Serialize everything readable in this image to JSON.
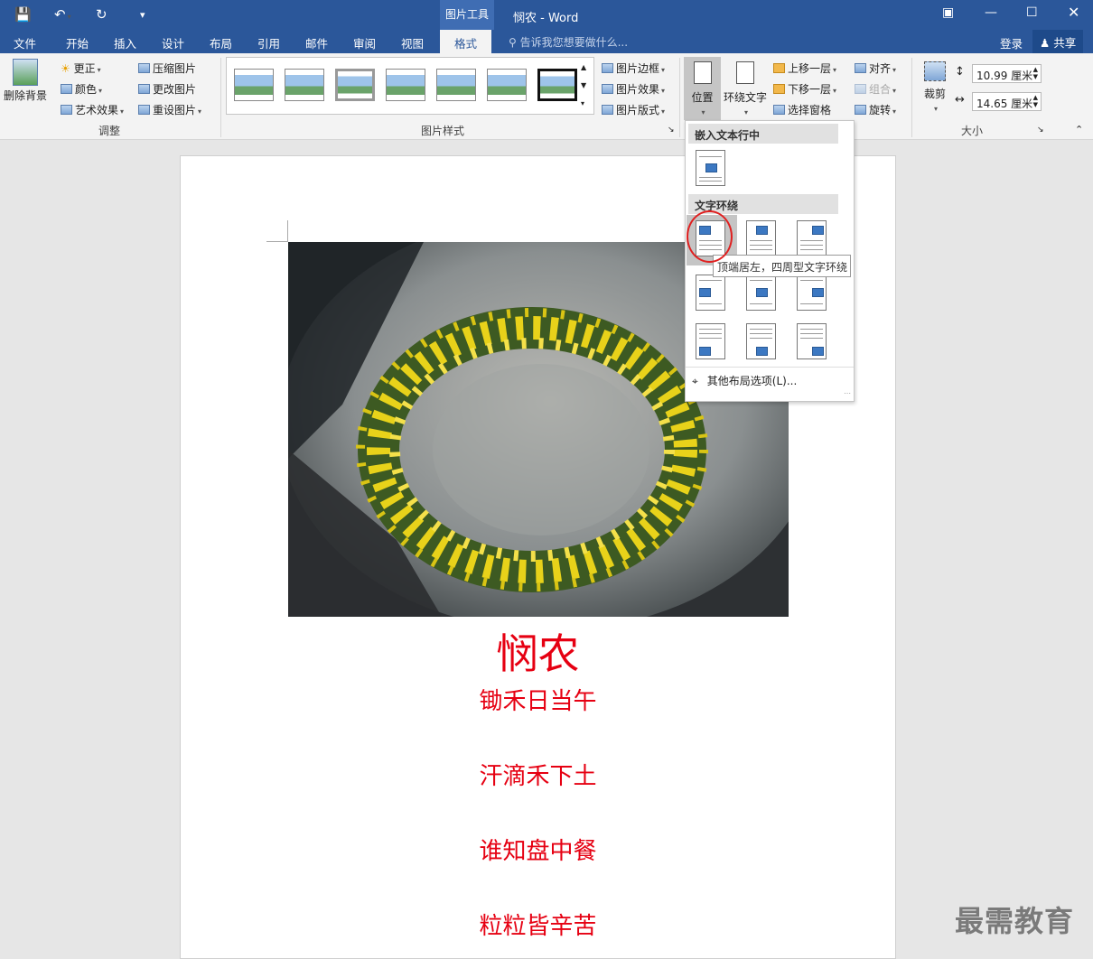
{
  "titlebar": {
    "context_group": "图片工具",
    "doc_title": "悯农 - Word"
  },
  "tabs": {
    "file": "文件",
    "home": "开始",
    "insert": "插入",
    "design": "设计",
    "layout": "布局",
    "references": "引用",
    "mailings": "邮件",
    "review": "审阅",
    "view": "视图",
    "format": "格式",
    "tell_me": "告诉我您想要做什么...",
    "signin": "登录",
    "share": "共享"
  },
  "ribbon": {
    "adjust": {
      "remove_bg": "删除背景",
      "corrections": "更正",
      "color": "颜色",
      "artistic": "艺术效果",
      "compress": "压缩图片",
      "change": "更改图片",
      "reset": "重设图片",
      "group_label": "调整"
    },
    "styles": {
      "border": "图片边框",
      "effects": "图片效果",
      "layout": "图片版式",
      "group_label": "图片样式"
    },
    "arrange": {
      "position": "位置",
      "wrap_text": "环绕文字",
      "bring_forward": "上移一层",
      "send_backward": "下移一层",
      "selection_pane": "选择窗格",
      "align": "对齐",
      "group": "组合",
      "rotate": "旋转"
    },
    "size": {
      "crop": "裁剪",
      "height": "10.99 厘米",
      "width": "14.65 厘米",
      "group_label": "大小"
    }
  },
  "dropdown": {
    "inline_header": "嵌入文本行中",
    "wrap_header": "文字环绕",
    "more_options": "其他布局选项(L)...",
    "tooltip": "顶端居左，四周型文字环绕"
  },
  "document": {
    "title": "悯农",
    "lines": [
      "锄禾日当午",
      "汗滴禾下土",
      "谁知盘中餐",
      "粒粒皆辛苦"
    ]
  },
  "watermark": "最需教育",
  "colors": {
    "accent": "#2b579a",
    "poem_red": "#e60012",
    "highlight_circle": "#e02020"
  }
}
